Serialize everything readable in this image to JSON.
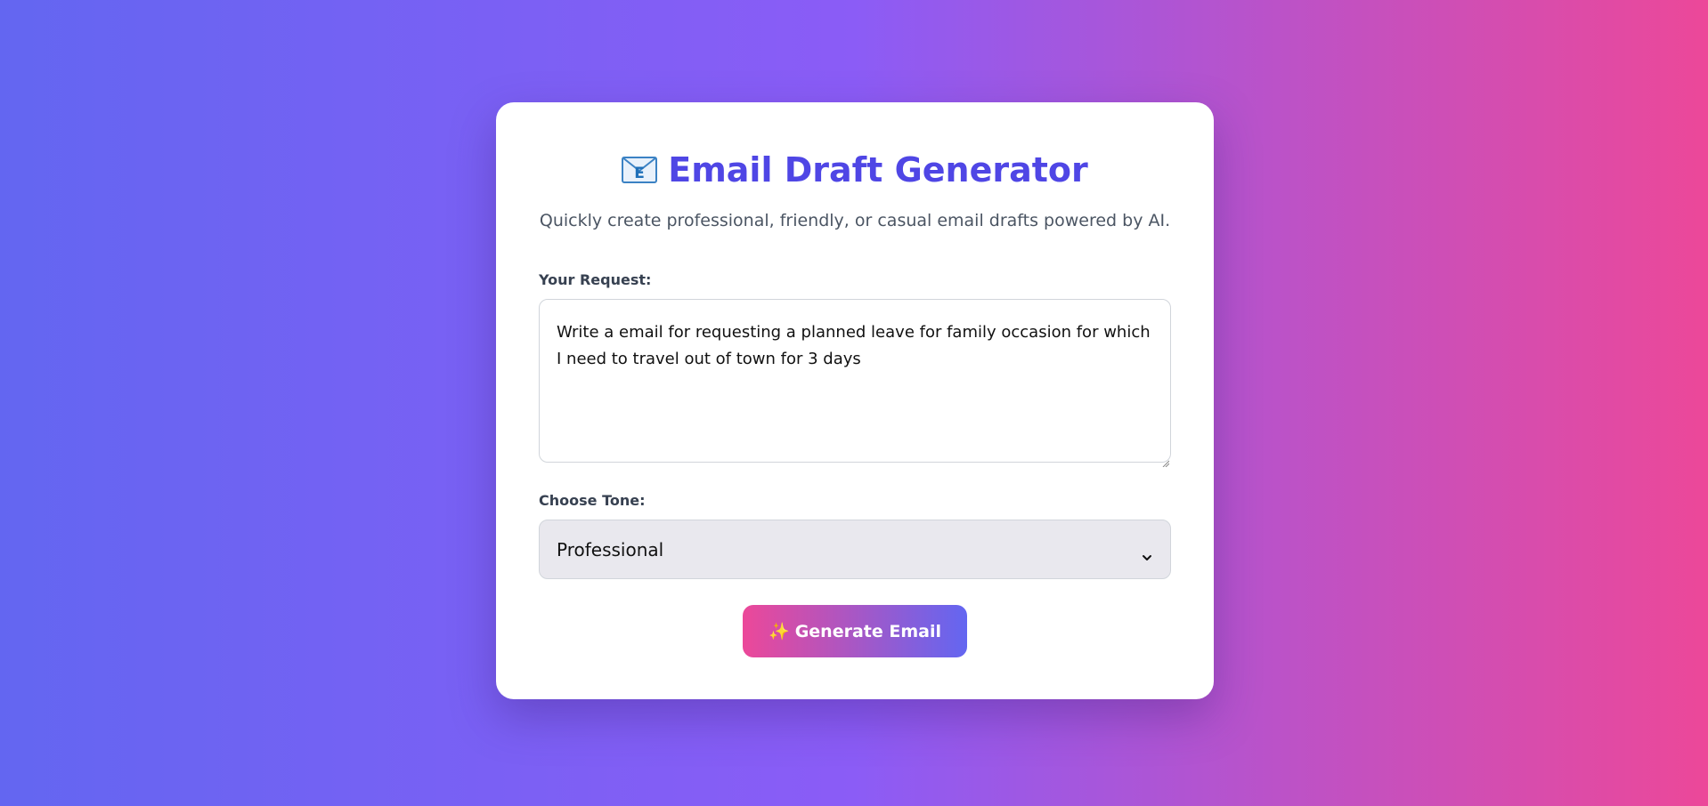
{
  "header": {
    "title": "Email Draft Generator",
    "title_icon": "envelope-icon",
    "subtitle": "Quickly create professional, friendly, or casual email drafts powered by AI."
  },
  "request": {
    "label": "Your Request:",
    "value": "Write a email for requesting a planned leave for family occasion for which I need to travel out of town for 3 days"
  },
  "tone": {
    "label": "Choose Tone:",
    "selected": "Professional"
  },
  "actions": {
    "generate_icon": "✨",
    "generate_label": "Generate Email"
  },
  "colors": {
    "accent": "#4f46e5",
    "gradient_start": "#6366f1",
    "gradient_mid": "#8b5cf6",
    "gradient_end": "#ec4899"
  }
}
